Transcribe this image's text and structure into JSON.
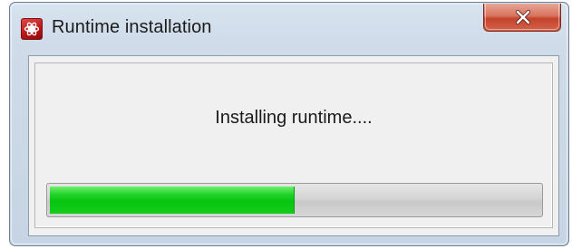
{
  "window": {
    "title": "Runtime installation",
    "app_icon": "app-logo-icon",
    "close_icon": "close-icon",
    "close_color": "#c4432b"
  },
  "content": {
    "status_text": "Installing runtime....",
    "progress": {
      "fraction": 0.5,
      "fill_color": "#07c510"
    }
  }
}
